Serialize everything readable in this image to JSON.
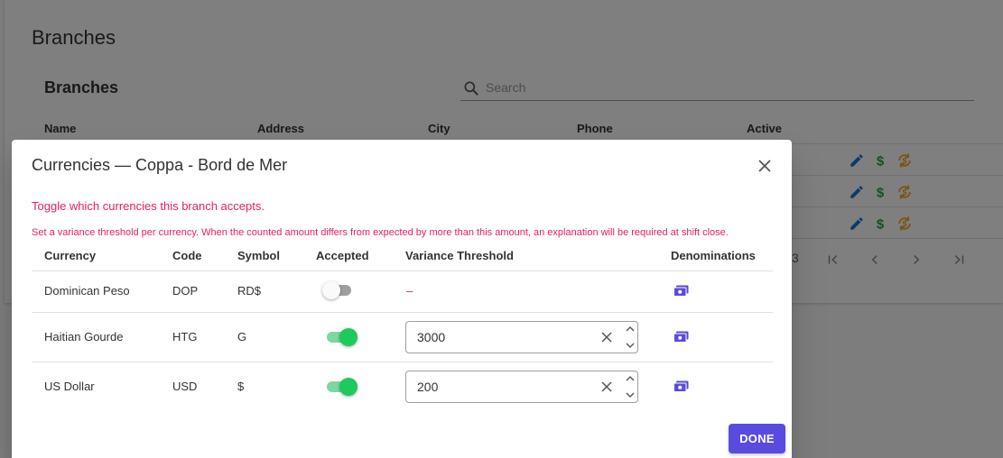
{
  "background": {
    "page_title": "Branches",
    "card_title": "Branches",
    "search": {
      "placeholder": "Search",
      "value": ""
    },
    "table_headers": [
      "Name",
      "Address",
      "City",
      "Phone",
      "Active"
    ],
    "pagination": {
      "range_tail": "3"
    }
  },
  "dialog": {
    "title": "Currencies — Coppa - Bord de Mer",
    "hint": "Toggle which currencies this branch accepts.",
    "variance_hint": "Set a variance threshold per currency. When the counted amount differs from expected by more than this amount, an explanation will be required at shift close.",
    "columns": {
      "currency": "Currency",
      "code": "Code",
      "symbol": "Symbol",
      "accepted": "Accepted",
      "threshold": "Variance Threshold",
      "denominations": "Denominations"
    },
    "rows": [
      {
        "currency": "Dominican Peso",
        "code": "DOP",
        "symbol": "RD$",
        "accepted": false,
        "threshold": "–"
      },
      {
        "currency": "Haitian Gourde",
        "code": "HTG",
        "symbol": "G",
        "accepted": true,
        "threshold": "3000"
      },
      {
        "currency": "US Dollar",
        "code": "USD",
        "symbol": "$",
        "accepted": true,
        "threshold": "200"
      }
    ],
    "done_label": "DONE"
  },
  "colors": {
    "accent": "#5a4be0",
    "hint": "#e91e63",
    "toggle_on": "#1ec95e",
    "edit_icon": "#1976d2",
    "dollar_icon": "#2e9e3e",
    "exchange_icon": "#f5a623"
  },
  "icons": {
    "search": "search-icon",
    "close": "close-icon",
    "edit": "pencil-icon",
    "dollar": "dollar-icon",
    "exchange": "currency-exchange-icon",
    "denominations": "cash-stack-icon",
    "first_page": "first-page-icon",
    "prev": "chevron-left-icon",
    "next": "chevron-right-icon",
    "last_page": "last-page-icon"
  }
}
